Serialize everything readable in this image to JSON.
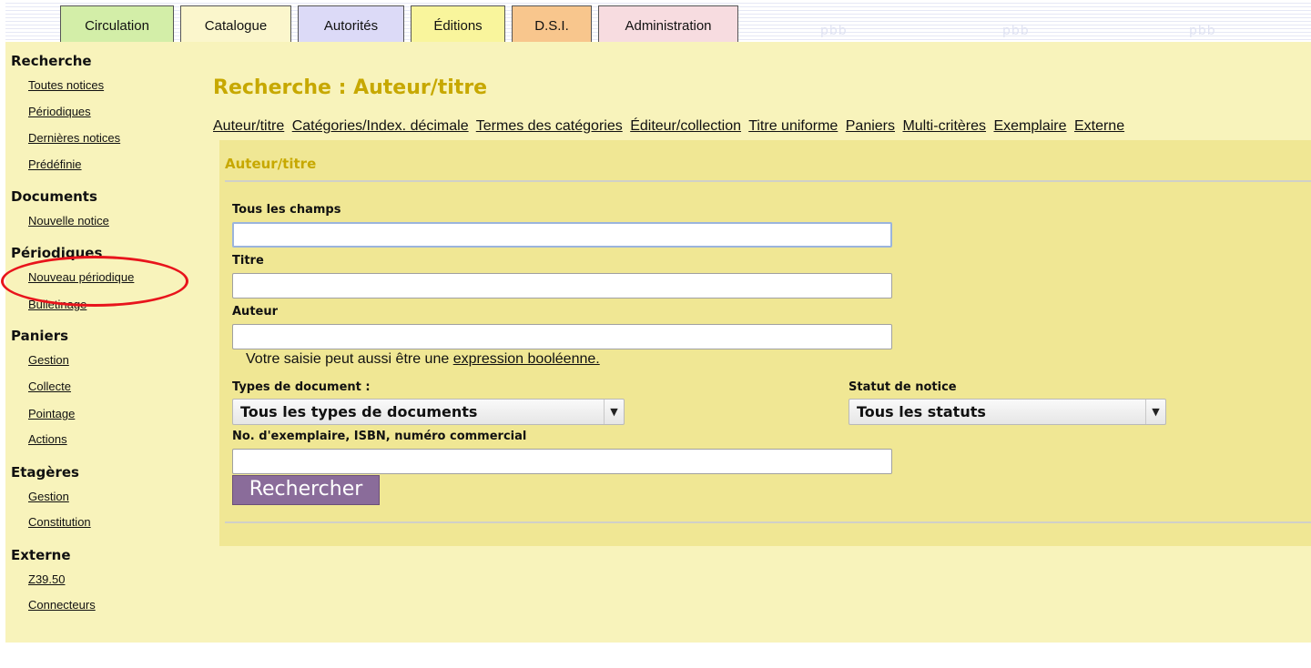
{
  "header": {
    "watermark": "pbb",
    "tabs": [
      {
        "label": "Circulation",
        "color": "#d3eea8"
      },
      {
        "label": "Catalogue",
        "color": "#fbf6cc"
      },
      {
        "label": "Autorités",
        "color": "#dcdaf7"
      },
      {
        "label": "Éditions",
        "color": "#f9f59c"
      },
      {
        "label": "D.S.I.",
        "color": "#f8c68d"
      },
      {
        "label": "Administration",
        "color": "#f7dce0"
      }
    ]
  },
  "sidebar": {
    "sections": [
      {
        "title": "Recherche",
        "links": [
          "Toutes notices",
          "Périodiques",
          "Dernières notices",
          "Prédéfinie"
        ]
      },
      {
        "title": "Documents",
        "links": [
          "Nouvelle notice"
        ]
      },
      {
        "title": "Périodiques",
        "links": [
          "Nouveau périodique",
          "Bulletinage"
        ]
      },
      {
        "title": "Paniers",
        "links": [
          "Gestion",
          "Collecte",
          "Pointage",
          "Actions"
        ]
      },
      {
        "title": "Etagères",
        "links": [
          "Gestion",
          "Constitution"
        ]
      },
      {
        "title": "Externe",
        "links": [
          "Z39.50",
          "Connecteurs"
        ]
      }
    ]
  },
  "main": {
    "title": "Recherche : Auteur/titre",
    "search_tabs": [
      "Auteur/titre",
      "Catégories/Index. décimale",
      "Termes des catégories",
      "Éditeur/collection",
      "Titre uniforme",
      "Paniers",
      "Multi-critères",
      "Exemplaire",
      "Externe"
    ],
    "panel_title": "Auteur/titre",
    "fields": {
      "all_fields_label": "Tous les champs",
      "all_fields_value": "",
      "title_label": "Titre",
      "title_value": "",
      "author_label": "Auteur",
      "author_value": "",
      "hint_prefix": "Votre saisie peut aussi être une ",
      "hint_link": "expression booléenne.",
      "doc_types_label": "Types de document :",
      "doc_types_value": "Tous les types de documents",
      "status_label": "Statut de notice",
      "status_value": "Tous les statuts",
      "copy_label": "No. d'exemplaire, ISBN, numéro commercial",
      "copy_value": ""
    },
    "search_button": "Rechercher"
  },
  "colors": {
    "page_bg": "#f8f3bb",
    "panel_bg": "#f0e794",
    "title_color": "#c7a800",
    "button_bg": "#8a6c9a",
    "highlight": "#e8141c"
  }
}
